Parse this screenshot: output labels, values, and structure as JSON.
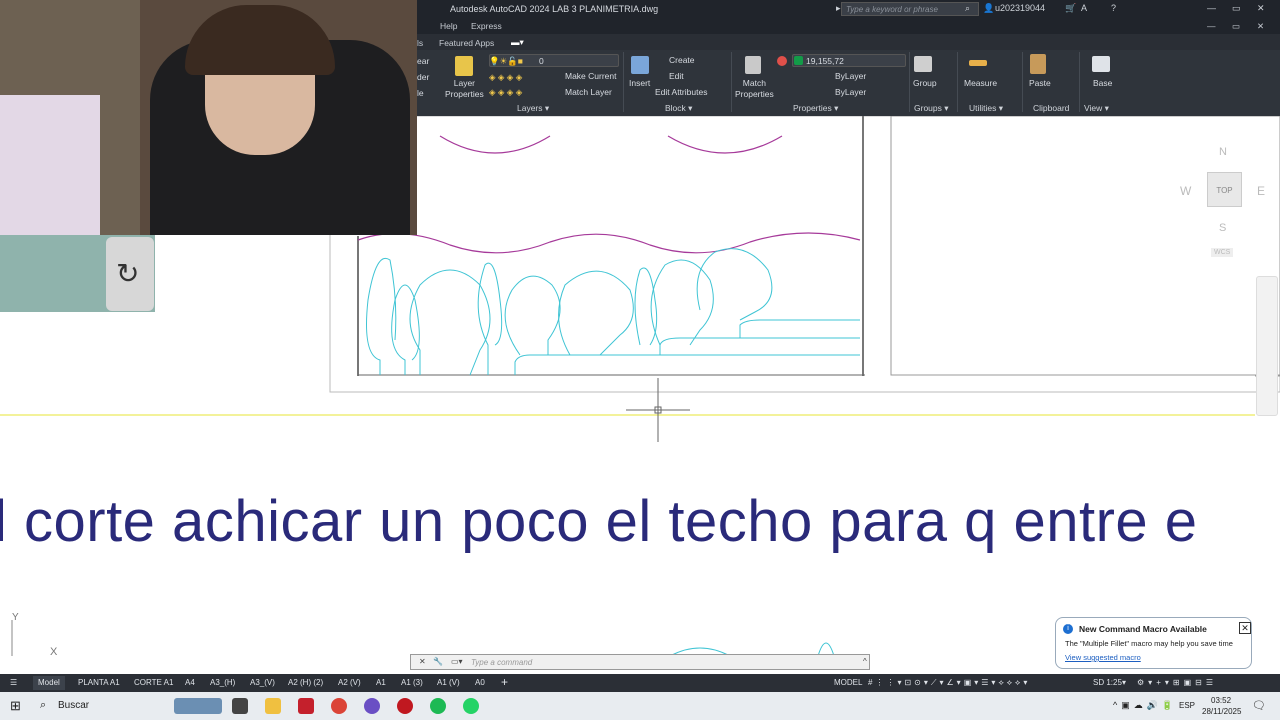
{
  "app": {
    "title": "Autodesk AutoCAD 2024   LAB 3 PLANIMETRIA.dwg",
    "search_placeholder": "Type a keyword or phrase",
    "user": "u202319044"
  },
  "menu": {
    "items": [
      "Help",
      "Express"
    ],
    "featured": "Featured Apps"
  },
  "ribbon": {
    "layer_properties": "Layer\nProperties",
    "layer_value": "0",
    "make_current": "Make Current",
    "match_layer": "Match Layer",
    "insert": "Insert",
    "create": "Create",
    "edit": "Edit",
    "edit_attributes": "Edit Attributes",
    "match_properties": "Match\nProperties",
    "color_value": "19,155,72",
    "bylayer1": "ByLayer",
    "bylayer2": "ByLayer",
    "group": "Group",
    "measure": "Measure",
    "paste": "Paste",
    "base": "Base",
    "groups": [
      "Layers ▾",
      "Block ▾",
      "Properties ▾",
      "Groups ▾",
      "Utilities ▾",
      "Clipboard",
      "View ▾"
    ],
    "left_cut": [
      "ear",
      "der",
      "le"
    ]
  },
  "viewcube": {
    "n": "N",
    "s": "S",
    "e": "E",
    "w": "W",
    "top": "TOP",
    "wcs": "WCS"
  },
  "ucs": {
    "x": "X",
    "y": "Y"
  },
  "caption": "l corte achicar un poco el techo para q entre e",
  "notification": {
    "title": "New Command Macro Available",
    "body": "The \"Multiple Fillet\" macro may help you save time",
    "link": "View suggested macro"
  },
  "command": {
    "placeholder": "Type a command"
  },
  "layout_tabs": [
    "Model",
    "PLANTA A1",
    "CORTE A1",
    "A4",
    "A3_(H)",
    "A3_(V)",
    "A2 (H) (2)",
    "A2 (V)",
    "A1",
    "A1 (3)",
    "A1 (V)",
    "A0"
  ],
  "status": {
    "model": "MODEL",
    "scale": "1:25",
    "ann": "SD"
  },
  "taskbar": {
    "search": "Buscar",
    "lang": "ESP",
    "time": "03:52",
    "date": "28/11/2025"
  },
  "colors": {
    "accent": "#0696d7",
    "tree": "#3fc4d4",
    "magenta": "#a63a9a",
    "caption": "#2a2a7a"
  }
}
